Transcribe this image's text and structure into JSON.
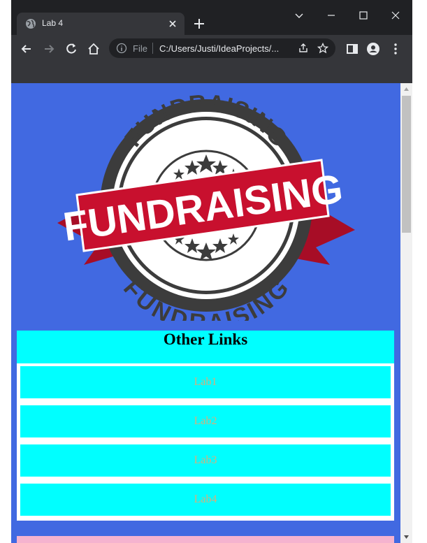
{
  "browser": {
    "tab": {
      "title": "Lab 4"
    },
    "omnibox": {
      "scheme_label": "File",
      "url": "C:/Users/Justi/IdeaProjects/..."
    }
  },
  "page": {
    "background_color": "#4169e1",
    "logo": {
      "top_text": "FUNDRAISING",
      "ribbon_text": "FUNDRAISING",
      "bottom_text": "FUNDRAISING"
    },
    "links_section": {
      "title": "Other Links",
      "items": [
        {
          "label": "Lab1"
        },
        {
          "label": "Lab2"
        },
        {
          "label": "Lab3"
        },
        {
          "label": "Lab4"
        }
      ]
    }
  },
  "colors": {
    "link_bg": "#00ffff",
    "link_text": "#d4b07c",
    "ribbon_red": "#c8102e",
    "badge_dark": "#3c3c3c"
  }
}
